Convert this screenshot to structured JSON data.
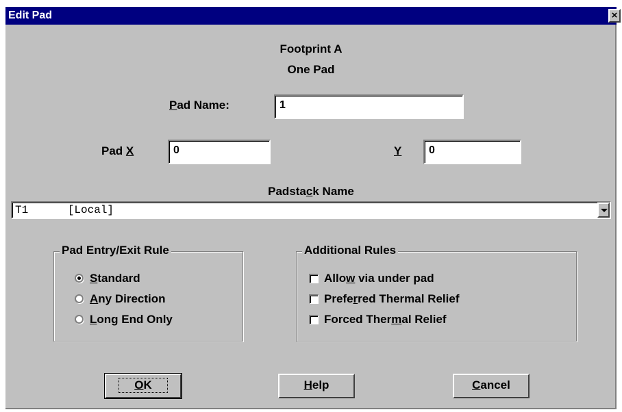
{
  "window": {
    "title": "Edit Pad",
    "close_glyph": "×"
  },
  "footprint": {
    "line1": "Footprint A",
    "line2": "One Pad"
  },
  "pad_name": {
    "label_pre": "",
    "label_ul": "P",
    "label_post": "ad Name:",
    "value": "1"
  },
  "pad_x": {
    "label_pre": "Pad ",
    "label_ul": "X",
    "label_post": "",
    "value": "0"
  },
  "pad_y": {
    "label_ul": "Y",
    "value": "0"
  },
  "padstack": {
    "label_pre": "Padsta",
    "label_ul": "c",
    "label_post": "k Name",
    "selected": "T1      [Local]"
  },
  "entry_exit": {
    "legend": "Pad Entry/Exit Rule",
    "options": [
      {
        "pre": "",
        "ul": "S",
        "post": "tandard",
        "selected": true
      },
      {
        "pre": "",
        "ul": "A",
        "post": "ny Direction",
        "selected": false
      },
      {
        "pre": "",
        "ul": "L",
        "post": "ong End Only",
        "selected": false
      }
    ]
  },
  "additional": {
    "legend": "Additional Rules",
    "options": [
      {
        "pre": "Allo",
        "ul": "w",
        "post": " via under pad",
        "checked": false
      },
      {
        "pre": "Prefe",
        "ul": "r",
        "post": "red Thermal Relief",
        "checked": false
      },
      {
        "pre": "Forced Ther",
        "ul": "m",
        "post": "al Relief",
        "checked": false
      }
    ]
  },
  "buttons": {
    "ok": {
      "ul": "O",
      "post": "K"
    },
    "help": {
      "ul": "H",
      "post": "elp"
    },
    "cancel": {
      "ul": "C",
      "post": "ancel"
    }
  }
}
